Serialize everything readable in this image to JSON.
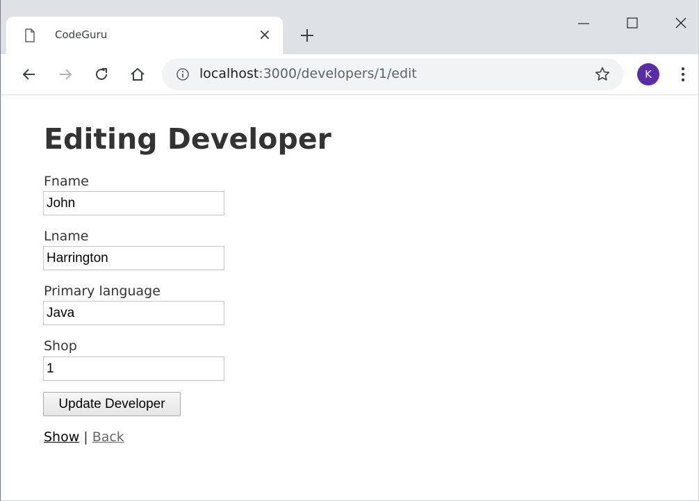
{
  "browser": {
    "tab_title": "CodeGuru",
    "tab_close_glyph": "×",
    "url_host": "localhost",
    "url_path": ":3000/developers/1/edit",
    "avatar_letter": "K"
  },
  "page": {
    "title": "Editing Developer",
    "fields": [
      {
        "label": "Fname",
        "value": "John"
      },
      {
        "label": "Lname",
        "value": "Harrington"
      },
      {
        "label": "Primary language",
        "value": "Java"
      },
      {
        "label": "Shop",
        "value": "1"
      }
    ],
    "submit_label": "Update Developer",
    "links": {
      "show": "Show",
      "separator": "|",
      "back": "Back"
    }
  },
  "colors": {
    "tabstrip_bg": "#dee1e6",
    "omnibox_bg": "#f1f3f4",
    "avatar_bg": "#5b2ca8",
    "text": "#333333",
    "link_visited": "#666666"
  },
  "icons": [
    "page-icon",
    "close-icon",
    "plus-icon",
    "minimize-icon",
    "maximize-icon",
    "window-close-icon",
    "back-arrow-icon",
    "forward-arrow-icon",
    "reload-icon",
    "home-icon",
    "info-icon",
    "star-icon",
    "kebab-menu-icon"
  ]
}
